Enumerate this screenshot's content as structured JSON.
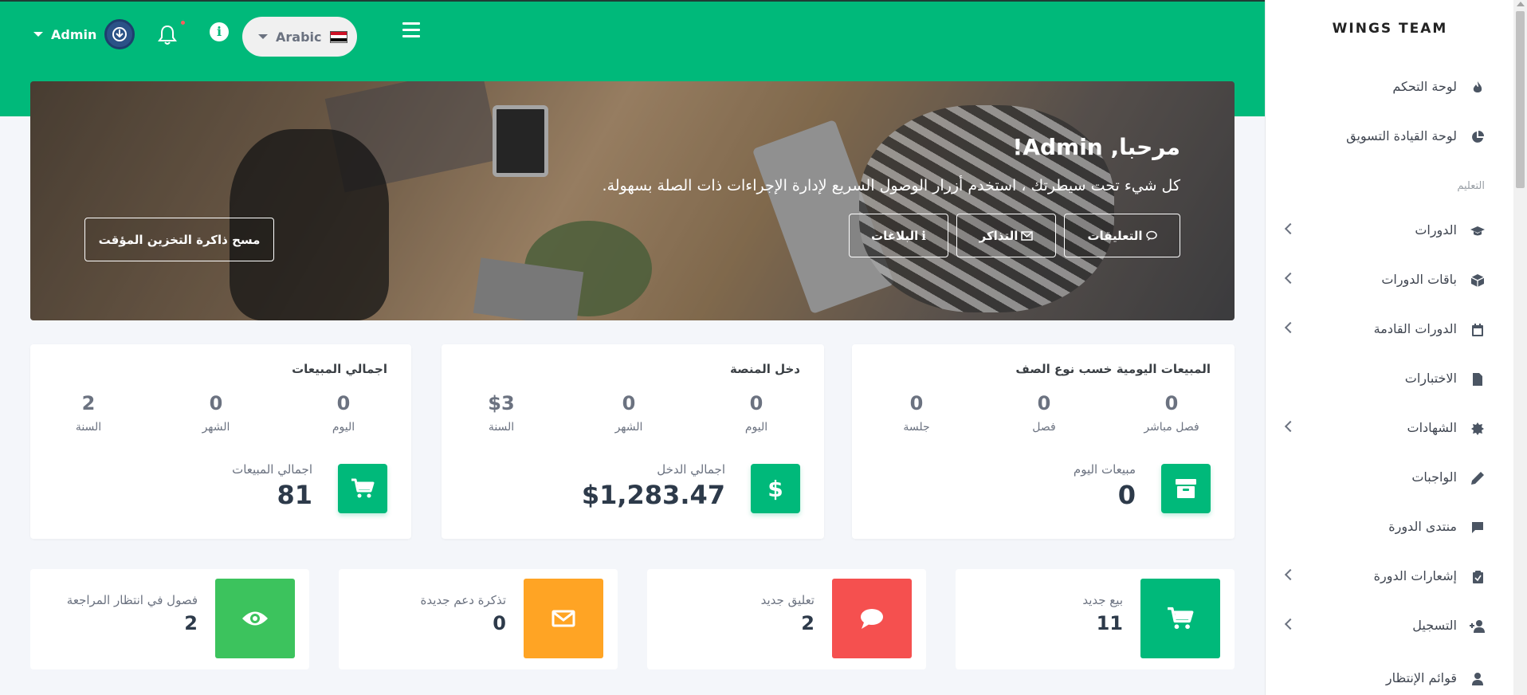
{
  "topbar": {
    "user_label": "Admin",
    "language_label": "Arabic"
  },
  "hero": {
    "title": "مرحبا, Admin!",
    "subtitle": "كل شيء تحت سيطرتك ، استخدم أزرار الوصول السريع لإدارة الإجراءات ذات الصلة بسهولة.",
    "buttons": {
      "comments": "التعليقات",
      "tickets": "التذاكر",
      "reports": "البلاغات",
      "clear_cache": "مسح ذاكرة التخزين المؤقت"
    }
  },
  "cards": {
    "daily_sales": {
      "title": "المبيعات اليومية خسب نوع الصف",
      "stats": [
        {
          "value": "0",
          "label": "فصل مباشر"
        },
        {
          "value": "0",
          "label": "فصل"
        },
        {
          "value": "0",
          "label": "جلسة"
        }
      ],
      "total_label": "مبيعات اليوم",
      "total_value": "0"
    },
    "platform_income": {
      "title": "دخل المنصة",
      "stats": [
        {
          "value": "0",
          "label": "اليوم"
        },
        {
          "value": "0",
          "label": "الشهر"
        },
        {
          "value": "$3",
          "label": "السنة"
        }
      ],
      "total_label": "اجمالي الدخل",
      "total_value": "$1,283.47"
    },
    "total_sales": {
      "title": "اجمالي المبيعات",
      "stats": [
        {
          "value": "0",
          "label": "اليوم"
        },
        {
          "value": "0",
          "label": "الشهر"
        },
        {
          "value": "2",
          "label": "السنة"
        }
      ],
      "total_label": "اجمالي المبيعات",
      "total_value": "81"
    }
  },
  "small_cards": [
    {
      "label": "بيع جديد",
      "value": "11",
      "color": "#00b97a",
      "icon": "cart-icon"
    },
    {
      "label": "تعليق جديد",
      "value": "2",
      "color": "#f5504f",
      "icon": "comment-icon"
    },
    {
      "label": "تذكرة دعم جديدة",
      "value": "0",
      "color": "#ffa424",
      "icon": "envelope-icon"
    },
    {
      "label": "فصول في انتظار المراجعة",
      "value": "2",
      "color": "#3cc35d",
      "icon": "eye-icon"
    }
  ],
  "sidebar": {
    "brand": "WINGS TEAM",
    "section_education": "التعليم",
    "items": [
      {
        "label": "لوحة التحكم",
        "icon": "fire-icon"
      },
      {
        "label": "لوحة القيادة التسويق",
        "icon": "pie-chart-icon"
      },
      {
        "label": "الدورات",
        "icon": "graduation-cap-icon"
      },
      {
        "label": "باقات الدورات",
        "icon": "box-icon"
      },
      {
        "label": "الدورات القادمة",
        "icon": "calendar-icon"
      },
      {
        "label": "الاختبارات",
        "icon": "file-icon"
      },
      {
        "label": "الشهادات",
        "icon": "badge-icon"
      },
      {
        "label": "الواجبات",
        "icon": "pencil-icon"
      },
      {
        "label": "منتدى الدورة",
        "icon": "chat-icon"
      },
      {
        "label": "إشعارات الدورة",
        "icon": "clipboard-icon"
      },
      {
        "label": "التسجيل",
        "icon": "user-plus-icon"
      },
      {
        "label": "قوائم الإنتظار",
        "icon": "user-clock-icon"
      }
    ]
  },
  "colors": {
    "primary": "#00b97a",
    "red": "#f5504f",
    "orange": "#ffa424",
    "green": "#3cc35d",
    "dark_text": "#2d3a4a"
  }
}
